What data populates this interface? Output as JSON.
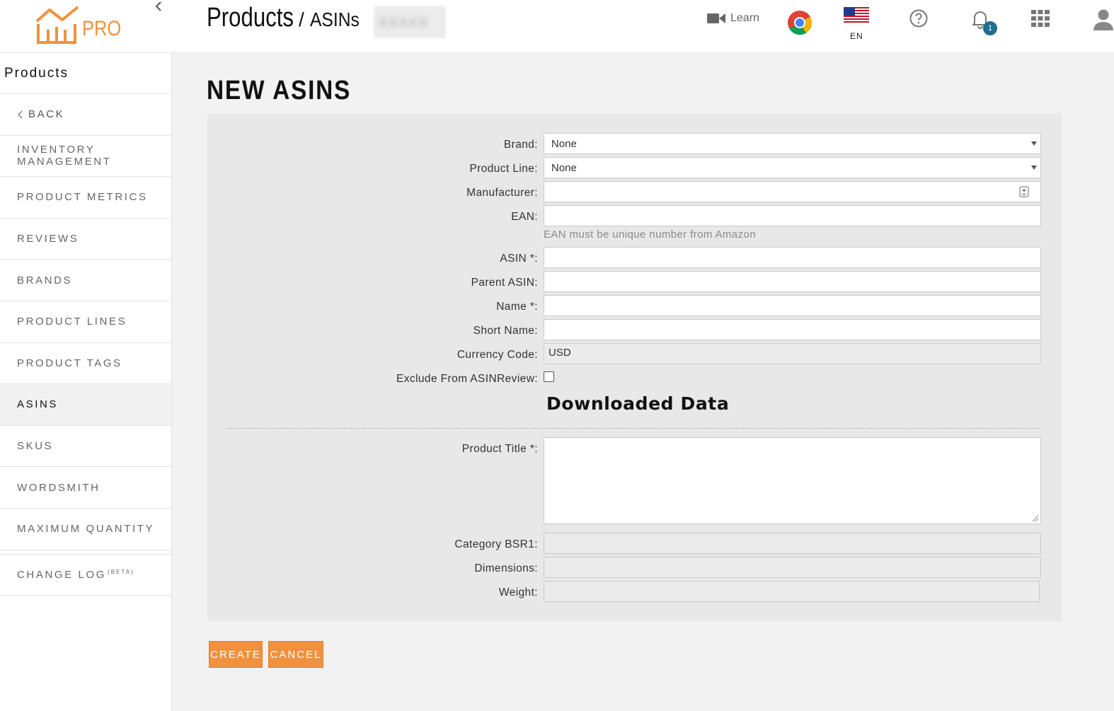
{
  "app": {
    "logo_text": "PRO",
    "brand_color": "#f0913f"
  },
  "header": {
    "breadcrumb_main": "Products",
    "breadcrumb_sep": "/",
    "breadcrumb_sub": "ASINs",
    "learn_label": "Learn",
    "language": "EN",
    "notification_count": "1",
    "icons": [
      "collapse-chevron-icon",
      "video-camera-icon",
      "chrome-icon",
      "us-flag-icon",
      "help-icon",
      "bell-icon",
      "apps-grid-icon",
      "user-icon"
    ]
  },
  "sidebar": {
    "title": "Products",
    "back_label": "BACK",
    "items": [
      {
        "label": "INVENTORY MANAGEMENT"
      },
      {
        "label": "PRODUCT METRICS"
      },
      {
        "label": "REVIEWS"
      },
      {
        "label": "BRANDS"
      },
      {
        "label": "PRODUCT LINES"
      },
      {
        "label": "PRODUCT TAGS"
      },
      {
        "label": "ASINS",
        "active": true
      },
      {
        "label": "SKUS"
      },
      {
        "label": "WORDSMITH"
      },
      {
        "label": "MAXIMUM QUANTITY"
      }
    ],
    "change_log_label": "CHANGE LOG",
    "change_log_badge": "(BETA)"
  },
  "page": {
    "title": "NEW ASINS"
  },
  "form": {
    "brand_label": "Brand:",
    "brand_value": "None",
    "product_line_label": "Product Line:",
    "product_line_value": "None",
    "manufacturer_label": "Manufacturer:",
    "manufacturer_value": "",
    "ean_label": "EAN:",
    "ean_value": "",
    "ean_hint": "EAN must be unique number from Amazon",
    "asin_label": "ASIN *:",
    "asin_value": "",
    "parent_asin_label": "Parent ASIN:",
    "parent_asin_value": "",
    "name_label": "Name *:",
    "name_value": "",
    "short_name_label": "Short Name:",
    "short_name_value": "",
    "currency_label": "Currency Code:",
    "currency_value": "USD",
    "exclude_label": "Exclude From ASINReview:",
    "exclude_checked": false,
    "downloaded_heading": "Downloaded Data",
    "product_title_label": "Product Title *:",
    "product_title_value": "",
    "category_bsr_label": "Category BSR1:",
    "category_bsr_value": "",
    "dimensions_label": "Dimensions:",
    "dimensions_value": "",
    "weight_label": "Weight:",
    "weight_value": ""
  },
  "actions": {
    "create_label": "CREATE",
    "cancel_label": "CANCEL"
  }
}
